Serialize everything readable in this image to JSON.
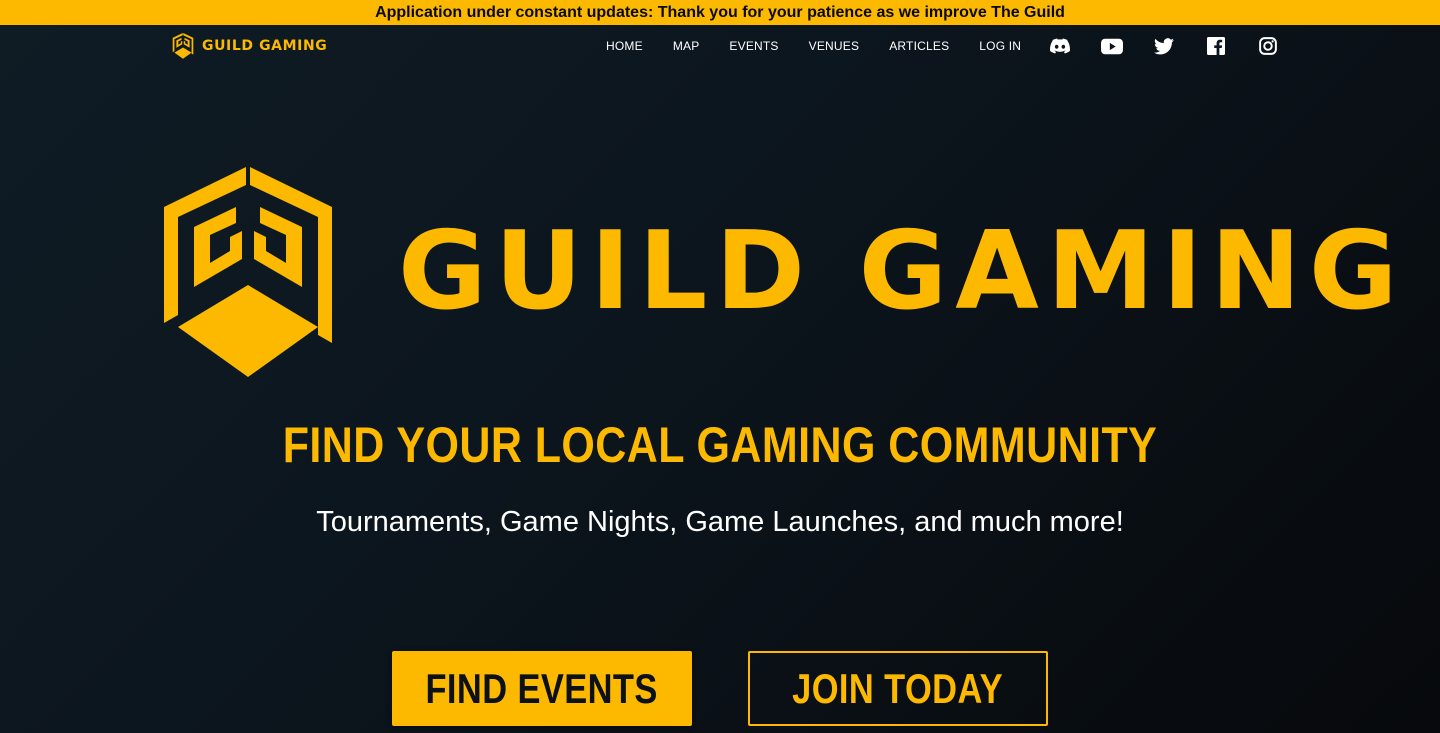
{
  "banner": {
    "text": "Application under constant updates: Thank you for your patience as we improve The Guild"
  },
  "brand": {
    "name": "GUILD GAMING",
    "logo_icon": "guild-hex-logo"
  },
  "nav": {
    "items": [
      {
        "label": "HOME"
      },
      {
        "label": "MAP"
      },
      {
        "label": "EVENTS"
      },
      {
        "label": "VENUES"
      },
      {
        "label": "ARTICLES"
      },
      {
        "label": "LOG IN"
      }
    ],
    "socials": [
      {
        "icon": "discord-icon"
      },
      {
        "icon": "youtube-icon"
      },
      {
        "icon": "twitter-icon"
      },
      {
        "icon": "facebook-icon"
      },
      {
        "icon": "instagram-icon"
      }
    ]
  },
  "hero": {
    "title": "GUILD GAMING",
    "tagline": "FIND YOUR LOCAL GAMING COMMUNITY",
    "subtitle": "Tournaments, Game Nights, Game Launches, and much more!",
    "primary_button": "FIND EVENTS",
    "secondary_button": "JOIN TODAY"
  },
  "colors": {
    "accent": "#fcb900",
    "background": "#0b1117",
    "text": "#ffffff"
  }
}
